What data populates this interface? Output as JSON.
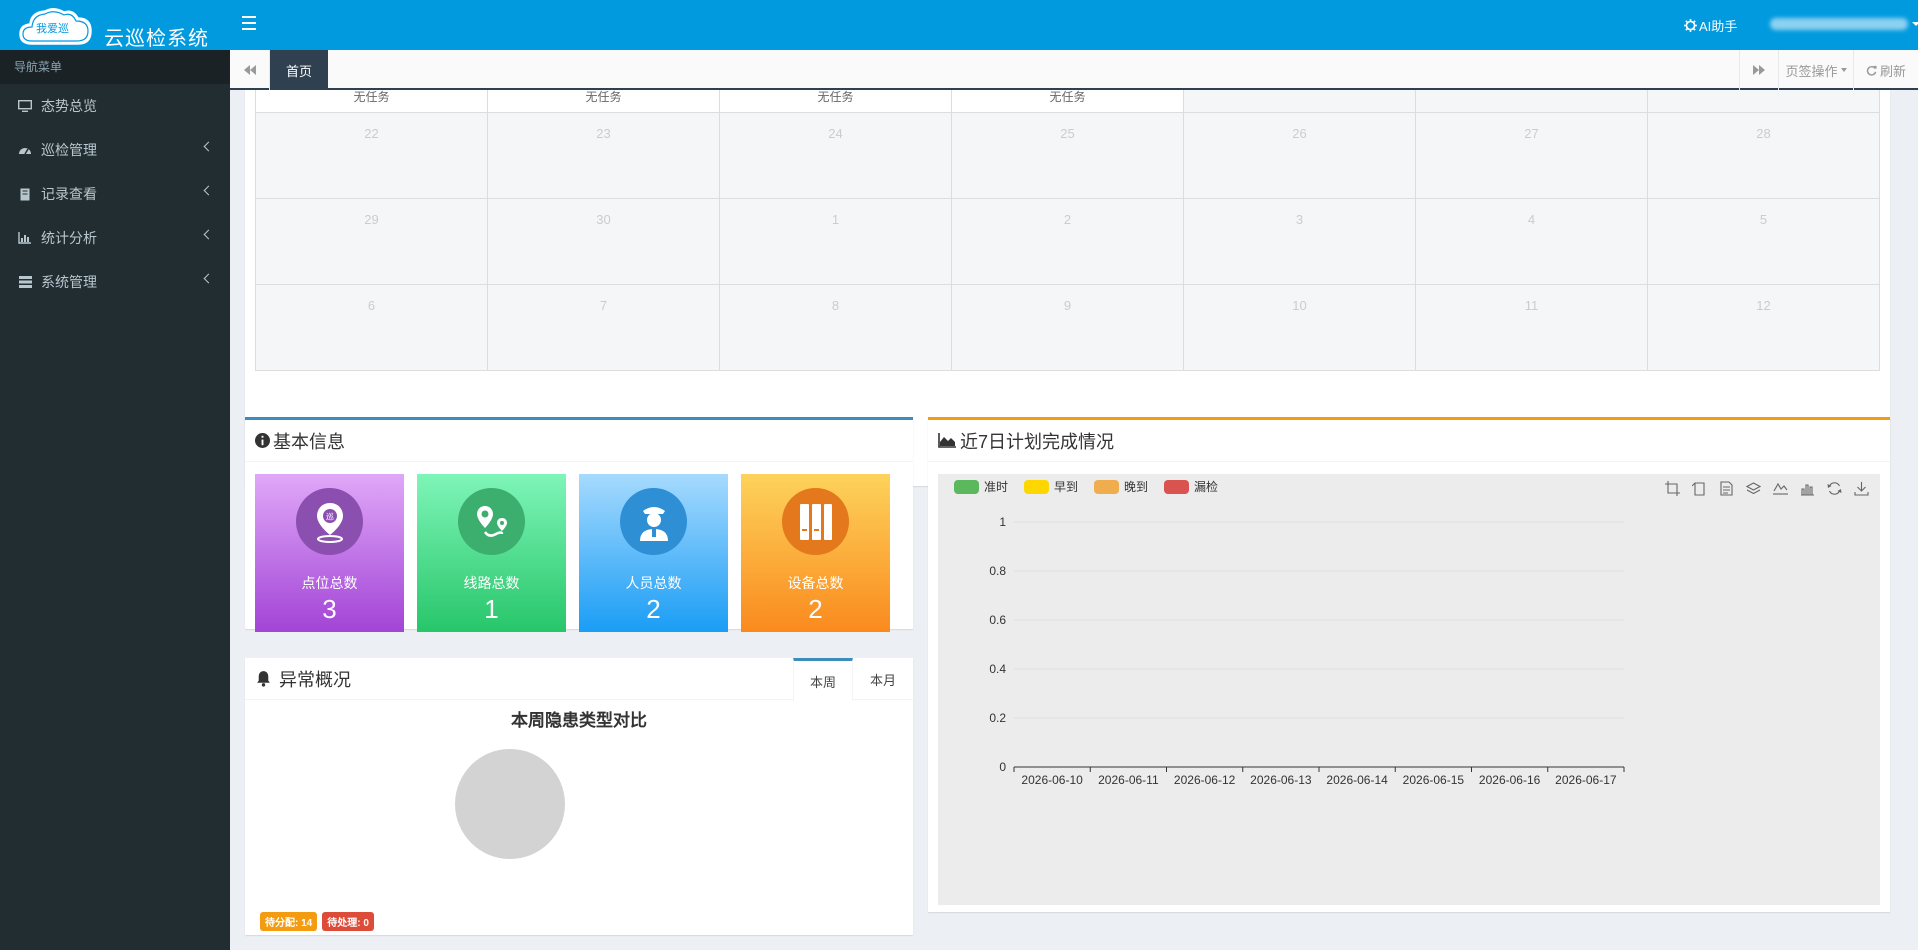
{
  "header": {
    "logo_text": "我爱巡",
    "app_title": "云巡检系统",
    "ai_assistant": "AI助手"
  },
  "sidebar": {
    "header": "导航菜单",
    "items": [
      {
        "label": "态势总览",
        "icon": "monitor-icon",
        "has_children": false
      },
      {
        "label": "巡检管理",
        "icon": "dashboard-icon",
        "has_children": true
      },
      {
        "label": "记录查看",
        "icon": "book-icon",
        "has_children": true
      },
      {
        "label": "统计分析",
        "icon": "bar-chart-icon",
        "has_children": true
      },
      {
        "label": "系统管理",
        "icon": "server-icon",
        "has_children": true
      }
    ]
  },
  "tabs": {
    "home": "首页",
    "page_ops": "页签操作",
    "refresh": "刷新"
  },
  "calendar": {
    "first_row": [
      "无任务",
      "无任务",
      "无任务",
      "无任务",
      "",
      "",
      ""
    ],
    "rows": [
      [
        "22",
        "23",
        "24",
        "25",
        "26",
        "27",
        "28"
      ],
      [
        "29",
        "30",
        "1",
        "2",
        "3",
        "4",
        "5"
      ],
      [
        "6",
        "7",
        "8",
        "9",
        "10",
        "11",
        "12"
      ]
    ]
  },
  "basic_info": {
    "title": "基本信息",
    "cards": [
      {
        "label": "点位总数",
        "value": "3",
        "icon": "location-pin-icon"
      },
      {
        "label": "线路总数",
        "value": "1",
        "icon": "route-icon"
      },
      {
        "label": "人员总数",
        "value": "2",
        "icon": "person-icon"
      },
      {
        "label": "设备总数",
        "value": "2",
        "icon": "device-icon"
      }
    ]
  },
  "abnormal": {
    "title": "异常概况",
    "tabs": [
      "本周",
      "本月"
    ],
    "active_tab": "本周",
    "chart_title": "本周隐患类型对比",
    "badges": [
      {
        "text": "待分配: 14",
        "color": "#f39c12"
      },
      {
        "text": "待处理: 0",
        "color": "#dd4b39"
      }
    ]
  },
  "plan": {
    "title": "近7日计划完成情况"
  },
  "chart_data": {
    "type": "bar",
    "title": "",
    "categories": [
      "2026-06-10",
      "2026-06-11",
      "2026-06-12",
      "2026-06-13",
      "2026-06-14",
      "2026-06-15",
      "2026-06-16",
      "2026-06-17"
    ],
    "series": [
      {
        "name": "准时",
        "color": "#5cb85c",
        "values": [
          0,
          0,
          0,
          0,
          0,
          0,
          0,
          0
        ]
      },
      {
        "name": "早到",
        "color": "#ffd700",
        "values": [
          0,
          0,
          0,
          0,
          0,
          0,
          0,
          0
        ]
      },
      {
        "name": "晚到",
        "color": "#f0ad4e",
        "values": [
          0,
          0,
          0,
          0,
          0,
          0,
          0,
          0
        ]
      },
      {
        "name": "漏检",
        "color": "#d9534f",
        "values": [
          0,
          0,
          0,
          0,
          0,
          0,
          0,
          0
        ]
      }
    ],
    "yticks": [
      "0",
      "0.2",
      "0.4",
      "0.6",
      "0.8",
      "1"
    ],
    "ylim": [
      0,
      1
    ],
    "grid": true,
    "legend": "top-left"
  },
  "pie_data": {
    "type": "pie",
    "title": "本周隐患类型对比",
    "slices": []
  },
  "colors": {
    "topbar": "#029adf",
    "sidebar": "#222d32",
    "card_point": [
      "#e0a8f8",
      "#a244d6"
    ],
    "card_route": [
      "#7ff5b8",
      "#27c66a"
    ],
    "card_person": [
      "#a6dafe",
      "#1a9df5"
    ],
    "card_device": [
      "#fdd35b",
      "#fa8a1e"
    ]
  }
}
